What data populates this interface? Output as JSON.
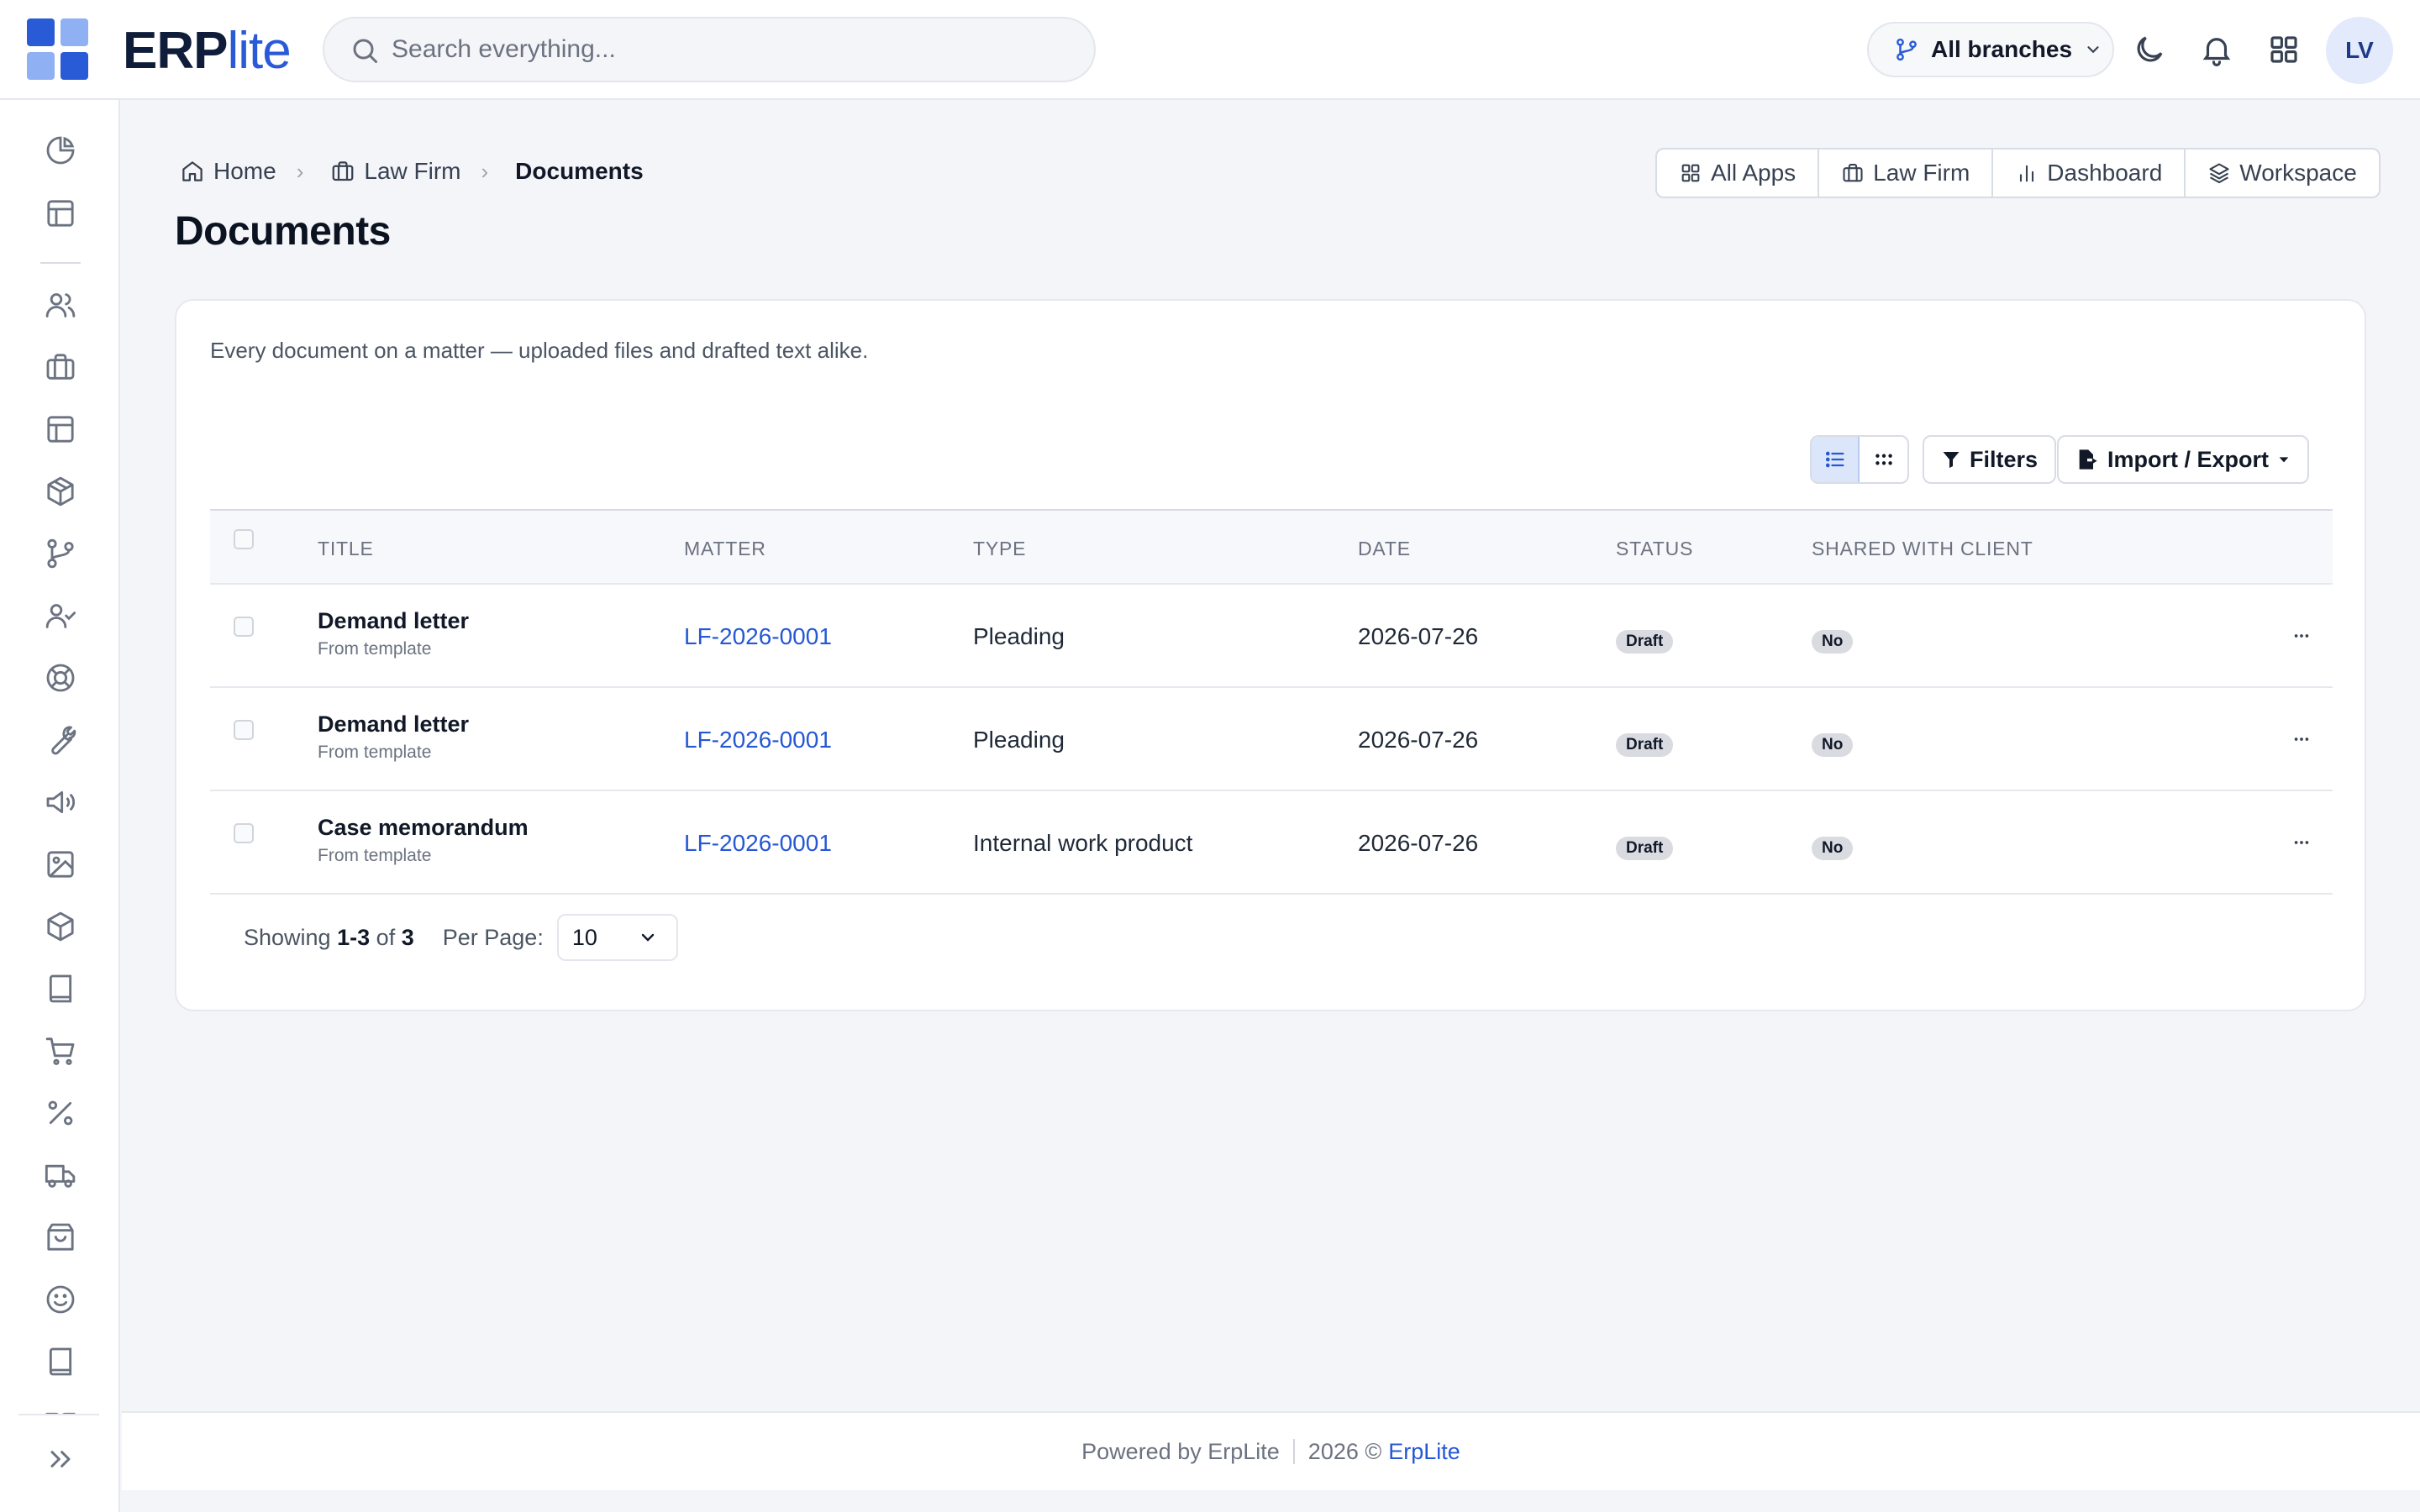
{
  "header": {
    "logo_bold": "ERP",
    "logo_light": "lite",
    "search_placeholder": "Search everything...",
    "branch_label": "All branches",
    "avatar_initials": "LV",
    "brand_color": "#2a5bd7"
  },
  "sidebar": {
    "icons": [
      "pie-chart-icon",
      "layout-icon",
      "users-icon",
      "briefcase-icon",
      "layout-icon",
      "package-icon",
      "git-branch-icon",
      "user-check-icon",
      "life-buoy-icon",
      "wrench-icon",
      "megaphone-icon",
      "image-icon",
      "box-icon",
      "book-icon",
      "cart-icon",
      "percent-icon",
      "truck-icon",
      "shopping-bag-icon",
      "smile-icon",
      "book-icon",
      "book-open-icon",
      "expand-icon"
    ]
  },
  "breadcrumb": {
    "home": "Home",
    "section": "Law Firm",
    "current": "Documents"
  },
  "page": {
    "title": "Documents",
    "description": "Every document on a matter — uploaded files and drafted text alike."
  },
  "app_links": {
    "all_apps": "All Apps",
    "law_firm": "Law Firm",
    "dashboard": "Dashboard",
    "workspace": "Workspace"
  },
  "toolbar": {
    "filters": "Filters",
    "import_export": "Import / Export"
  },
  "table": {
    "columns": {
      "title": "TITLE",
      "matter": "MATTER",
      "type": "TYPE",
      "date": "DATE",
      "status": "STATUS",
      "shared": "SHARED WITH CLIENT"
    },
    "rows": [
      {
        "title": "Demand letter",
        "subtitle": "From template",
        "matter": "LF-2026-0001",
        "type": "Pleading",
        "date": "2026-07-26",
        "status": "Draft",
        "shared": "No"
      },
      {
        "title": "Demand letter",
        "subtitle": "From template",
        "matter": "LF-2026-0001",
        "type": "Pleading",
        "date": "2026-07-26",
        "status": "Draft",
        "shared": "No"
      },
      {
        "title": "Case memorandum",
        "subtitle": "From template",
        "matter": "LF-2026-0001",
        "type": "Internal work product",
        "date": "2026-07-26",
        "status": "Draft",
        "shared": "No"
      }
    ]
  },
  "pager": {
    "showing_label": "Showing",
    "from": "1",
    "dash": "-",
    "to": "3",
    "of_label": "of",
    "total": "3",
    "per_page_label": "Per Page:",
    "per_page_value": "10"
  },
  "footer": {
    "powered_by": "Powered by ErpLite",
    "copyright": "2026 ©",
    "link": "ErpLite"
  }
}
